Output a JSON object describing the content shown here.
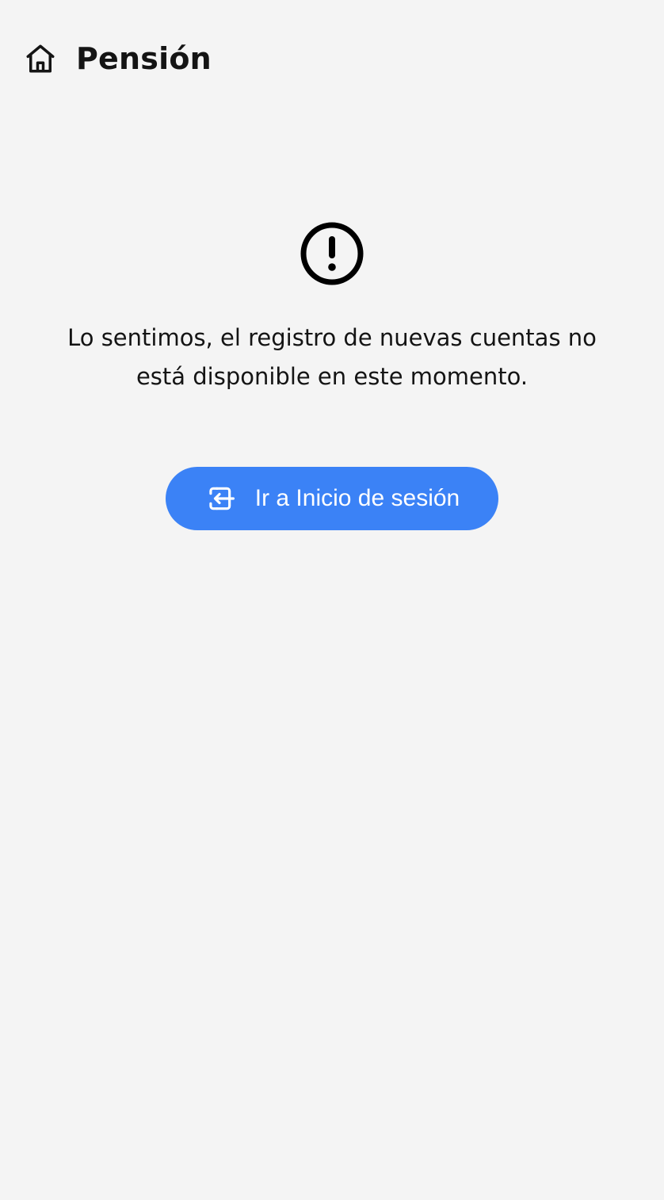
{
  "header": {
    "title": "Pensión",
    "home_icon": "home-icon"
  },
  "main": {
    "alert_icon": "alert-circle-icon",
    "message": "Lo sentimos, el registro de nuevas cuentas no está disponible en este momento.",
    "login_button": {
      "label": "Ir a Inicio de sesión",
      "icon": "login-icon"
    }
  },
  "colors": {
    "background": "#f4f4f4",
    "primary_button": "#3b82f6",
    "text": "#141414"
  }
}
